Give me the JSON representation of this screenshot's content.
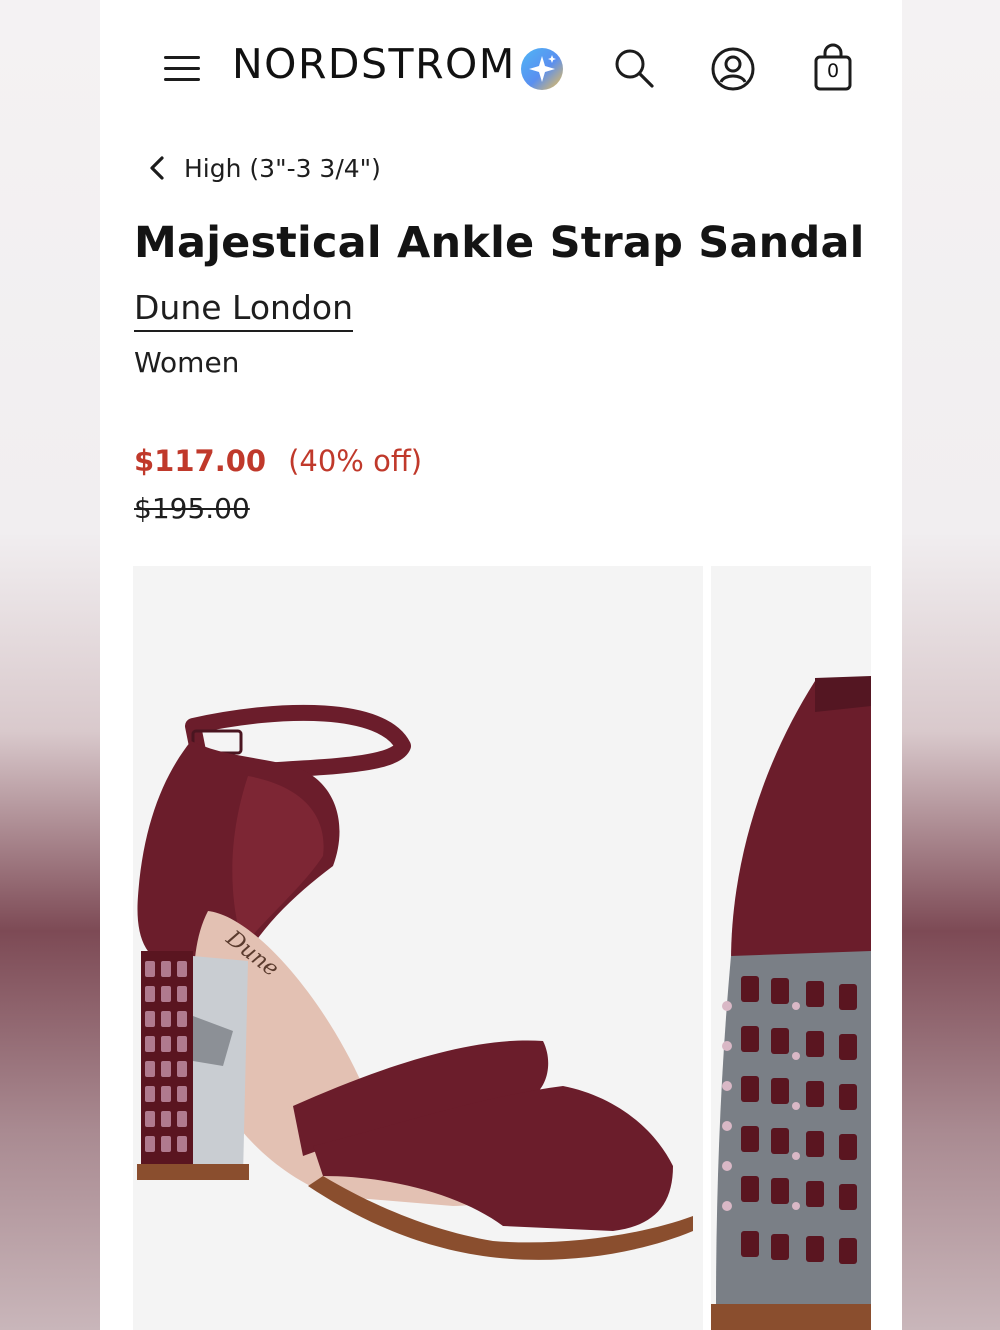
{
  "header": {
    "logo": "NORDSTROM",
    "icons": [
      "menu-icon",
      "ai-sparkle-icon",
      "search-icon",
      "account-icon",
      "shopping-bag-icon"
    ],
    "bag_count": "0"
  },
  "breadcrumb": {
    "label": "High (3\"-3 3/4\")"
  },
  "product": {
    "title": "Majestical Ankle Strap Sandal",
    "brand": "Dune London",
    "gender": "Women",
    "sale_price": "$117.00",
    "discount": "(40% off)",
    "original_price": "$195.00",
    "logo_on_insole": "Dune"
  },
  "colors": {
    "sale": "#c0392b",
    "shoe": "#6b1d2b",
    "text": "#141414"
  }
}
